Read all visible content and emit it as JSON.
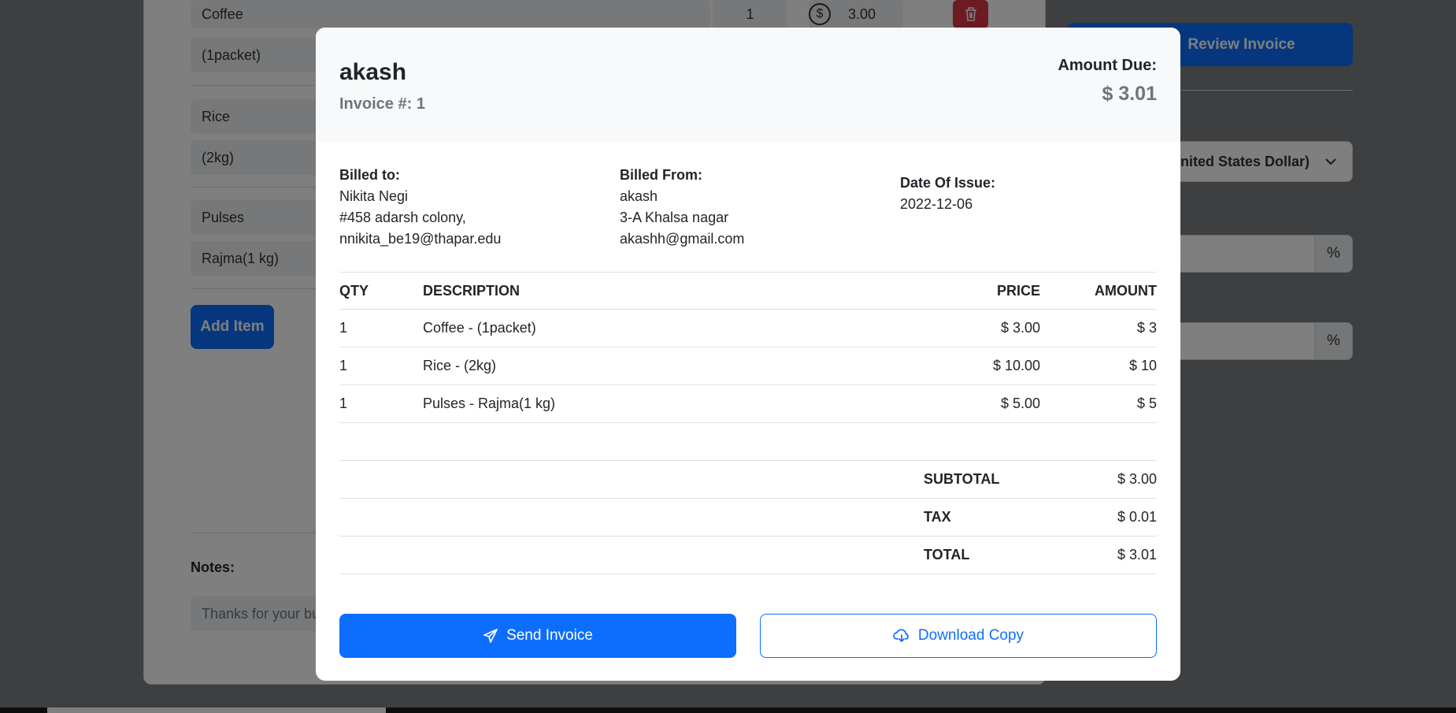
{
  "background": {
    "items": [
      {
        "name": "Coffee",
        "description": " (1packet)",
        "qty": "1",
        "price": "3.00"
      },
      {
        "name": "Rice",
        "description": "(2kg)"
      },
      {
        "name": "Pulses",
        "description": "Rajma(1 kg)"
      }
    ],
    "add_item_label": "Add Item",
    "notes_label": "Notes:",
    "notes_value": "Thanks for your business!",
    "review_button_label": "Review Invoice",
    "currency_value": "USD (United States Dollar)",
    "percent_symbol": "%",
    "dollar_symbol": "$"
  },
  "modal": {
    "business_name": "akash",
    "invoice_number_label": "Invoice #: 1",
    "amount_due_label": "Amount Due:",
    "amount_due_value": "$ 3.01",
    "billed_to": {
      "label": "Billed to:",
      "name": "Nikita Negi",
      "address": "#458 adarsh colony,",
      "email": "nnikita_be19@thapar.edu"
    },
    "billed_from": {
      "label": "Billed From:",
      "name": "akash",
      "address": "3-A Khalsa nagar",
      "email": "akashh@gmail.com"
    },
    "date_of_issue": {
      "label": "Date Of Issue:",
      "value": "2022-12-06"
    },
    "table": {
      "headers": {
        "qty": "QTY",
        "description": "DESCRIPTION",
        "price": "PRICE",
        "amount": "AMOUNT"
      },
      "rows": [
        {
          "qty": "1",
          "description": "Coffee - (1packet)",
          "price": "$ 3.00",
          "amount": "$ 3"
        },
        {
          "qty": "1",
          "description": "Rice - (2kg)",
          "price": "$ 10.00",
          "amount": "$ 10"
        },
        {
          "qty": "1",
          "description": "Pulses - Rajma(1 kg)",
          "price": "$ 5.00",
          "amount": "$ 5"
        }
      ]
    },
    "totals": [
      {
        "label": "SUBTOTAL",
        "value": "$ 3.00"
      },
      {
        "label": "TAX",
        "value": "$ 0.01"
      },
      {
        "label": "TOTAL",
        "value": "$ 3.01"
      }
    ],
    "send_button_label": "Send Invoice",
    "download_button_label": "Download Copy"
  },
  "colors": {
    "primary": "#0d6efd",
    "danger": "#dc3545",
    "muted": "#6c757d"
  }
}
